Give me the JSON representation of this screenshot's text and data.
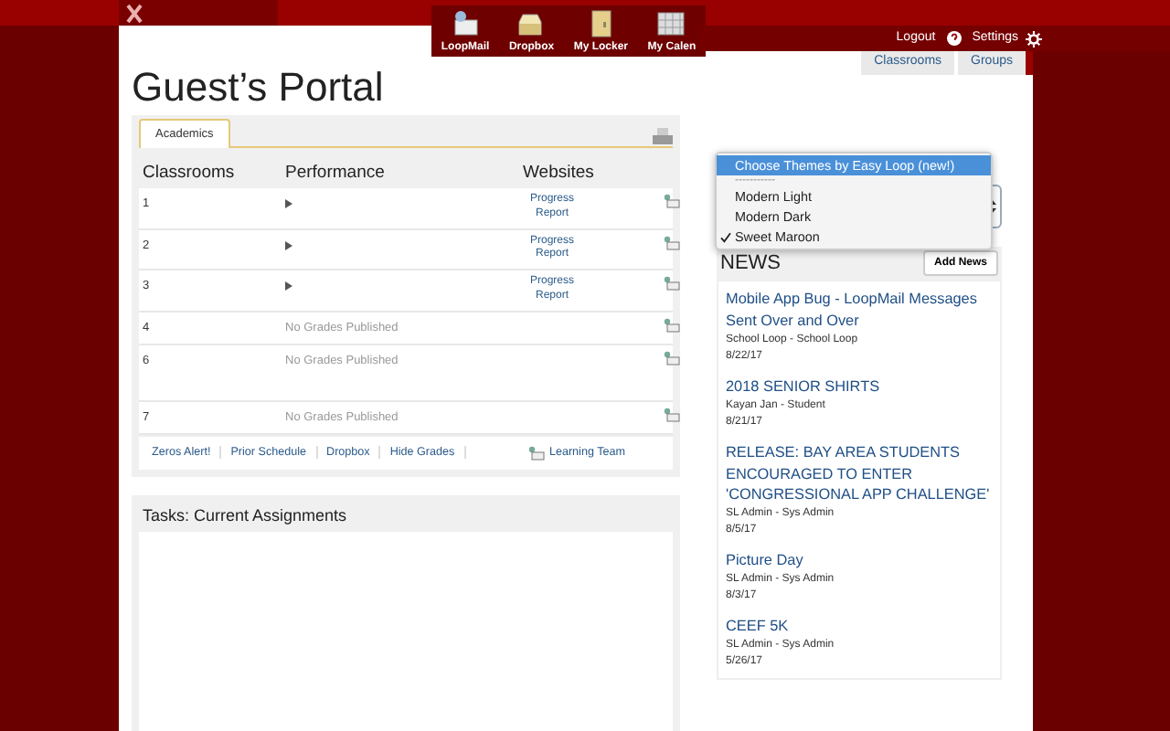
{
  "nav_apps": [
    {
      "label": "LoopMail",
      "kind": "mail"
    },
    {
      "label": "Dropbox",
      "kind": "tray"
    },
    {
      "label": "My Locker",
      "kind": "locker"
    },
    {
      "label": "My Calen",
      "kind": "calendar"
    }
  ],
  "header_links": {
    "logout": "Logout",
    "settings": "Settings"
  },
  "page_title": "Guest’s Portal",
  "view_tabs": [
    "Classrooms",
    "Groups"
  ],
  "academics": {
    "tab": "Academics",
    "columns": [
      "Classrooms",
      "Performance",
      "Websites"
    ],
    "rows": [
      {
        "classroom": "1",
        "kind": "graded",
        "link": "Progress Report"
      },
      {
        "classroom": "2",
        "kind": "graded",
        "link": "Progress Report"
      },
      {
        "classroom": "3",
        "kind": "graded",
        "link": "Progress Report"
      },
      {
        "classroom": "4",
        "kind": "none",
        "note": "No Grades Published"
      },
      {
        "classroom": "6",
        "kind": "none",
        "note": "No Grades Published"
      },
      {
        "classroom": "7",
        "kind": "none",
        "note": "No Grades Published"
      }
    ],
    "footer_links": [
      "Zeros Alert!",
      "Prior Schedule",
      "Dropbox",
      "Hide Grades"
    ],
    "learning_team": "Learning Team"
  },
  "tasks": {
    "title": "Tasks: Current Assignments"
  },
  "theme_menu": {
    "items": [
      {
        "label": "Choose Themes by Easy Loop (new!)",
        "kind": "option",
        "selected": true,
        "checked": false
      },
      {
        "label": "-----------",
        "kind": "separator"
      },
      {
        "label": "Modern Light",
        "kind": "option",
        "selected": false,
        "checked": false
      },
      {
        "label": "Modern Dark",
        "kind": "option",
        "selected": false,
        "checked": false
      },
      {
        "label": "Sweet Maroon",
        "kind": "option",
        "selected": false,
        "checked": true
      }
    ]
  },
  "news": {
    "title": "NEWS",
    "add_button": "Add News",
    "items": [
      {
        "title": "Mobile App Bug - LoopMail Messages Sent Over and Over",
        "author": "School Loop - School Loop",
        "date": "8/22/17"
      },
      {
        "title": "2018 SENIOR SHIRTS",
        "author": "Kayan Jan - Student",
        "date": "8/21/17"
      },
      {
        "title": "RELEASE: BAY AREA STUDENTS ENCOURAGED TO ENTER 'CONGRESSIONAL APP CHALLENGE'",
        "author": "SL Admin - Sys Admin",
        "date": "8/5/17"
      },
      {
        "title": "Picture Day",
        "author": "SL Admin - Sys Admin",
        "date": "8/3/17"
      },
      {
        "title": "CEEF 5K",
        "author": "SL Admin - Sys Admin",
        "date": "5/26/17"
      }
    ]
  }
}
